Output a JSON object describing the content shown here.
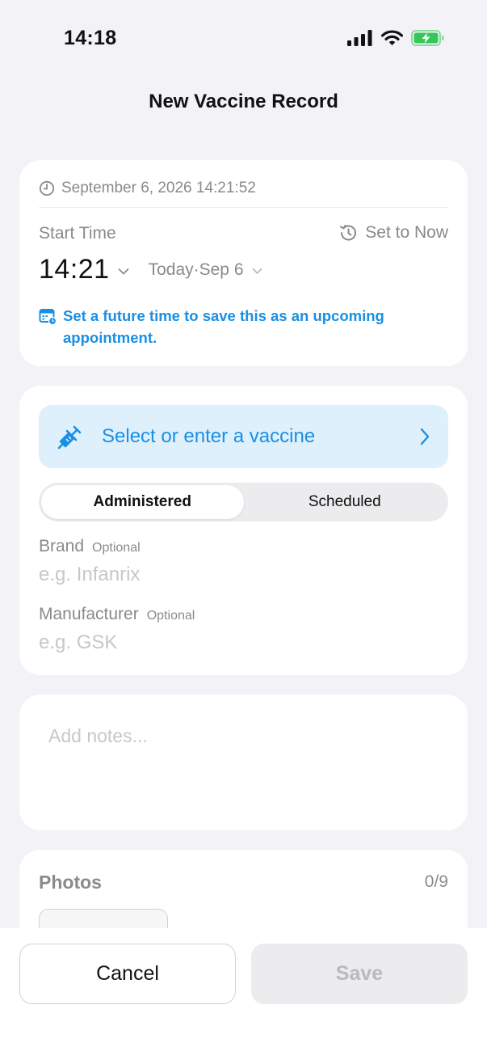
{
  "status_bar": {
    "time": "14:18"
  },
  "nav": {
    "title": "New Vaccine Record"
  },
  "time_card": {
    "timestamp": "September 6, 2026 14:21:52",
    "start_time_label": "Start Time",
    "set_to_now_label": "Set to Now",
    "time_value": "14:21",
    "date_value": "Today·Sep 6",
    "appointment_hint": "Set a future time to save this as an upcoming appointment."
  },
  "vaccine_card": {
    "select_label": "Select or enter a vaccine",
    "segments": [
      "Administered",
      "Scheduled"
    ],
    "selected_segment": "Administered",
    "brand_label": "Brand",
    "brand_optional": "Optional",
    "brand_placeholder": "e.g. Infanrix",
    "manufacturer_label": "Manufacturer",
    "manufacturer_optional": "Optional",
    "manufacturer_placeholder": "e.g. GSK"
  },
  "notes": {
    "placeholder": "Add notes..."
  },
  "photos": {
    "title": "Photos",
    "count": "0/9"
  },
  "actions": {
    "cancel": "Cancel",
    "save": "Save"
  },
  "colors": {
    "accent": "#1a8fe3",
    "background": "#f2f2f7",
    "battery": "#34c759"
  },
  "icons": [
    "cellular-signal-icon",
    "wifi-icon",
    "battery-charging-icon",
    "clock-icon",
    "history-icon",
    "chevron-down-icon",
    "calendar-icon",
    "syringe-icon",
    "chevron-right-icon"
  ]
}
